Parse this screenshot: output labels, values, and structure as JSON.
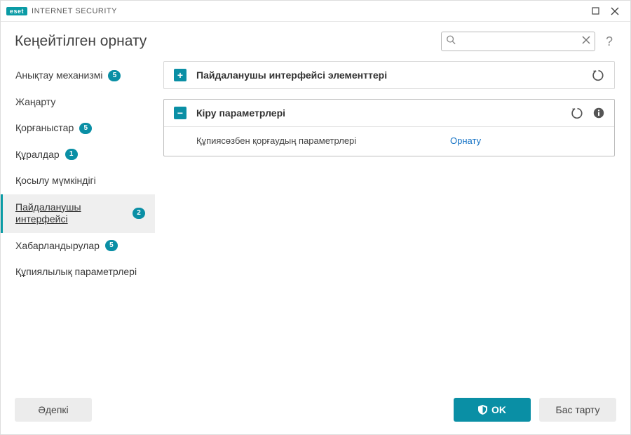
{
  "app": {
    "brand": "INTERNET SECURITY",
    "logo_text": "eset"
  },
  "header": {
    "title": "Кеңейтілген орнату",
    "search_placeholder": "",
    "help_glyph": "?"
  },
  "sidebar": {
    "items": [
      {
        "label": "Анықтау механизмі",
        "badge": "5",
        "active": false
      },
      {
        "label": "Жаңарту",
        "badge": null,
        "active": false
      },
      {
        "label": "Қорғаныстар",
        "badge": "5",
        "active": false
      },
      {
        "label": "Құралдар",
        "badge": "1",
        "active": false
      },
      {
        "label": "Қосылу мүмкіндігі",
        "badge": null,
        "active": false
      },
      {
        "label": "Пайдаланушы интерфейсі",
        "badge": "2",
        "active": true
      },
      {
        "label": "Хабарландырулар",
        "badge": "5",
        "active": false
      },
      {
        "label": "Құпиялылық параметрлері",
        "badge": null,
        "active": false
      }
    ]
  },
  "panels": [
    {
      "id": "ui-elements",
      "expanded": false,
      "title": "Пайдаланушы интерфейсі элементтері",
      "show_reset": true,
      "show_info": false
    },
    {
      "id": "access-params",
      "expanded": true,
      "title": "Кіру параметрлері",
      "show_reset": true,
      "show_info": true,
      "rows": [
        {
          "label": "Құпиясөзбен қорғаудың параметрлері",
          "action": "Орнату"
        }
      ]
    }
  ],
  "footer": {
    "default_btn": "Әдепкі",
    "ok_btn": "OK",
    "cancel_btn": "Бас тарту"
  }
}
